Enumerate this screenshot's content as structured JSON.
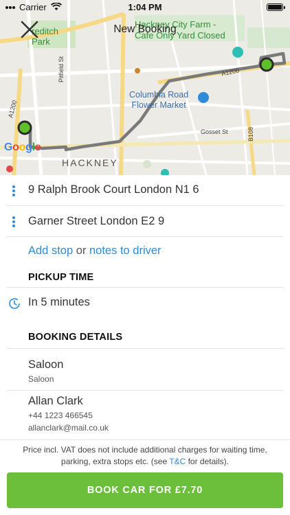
{
  "status_bar": {
    "carrier": "Carrier",
    "time": "1:04 PM"
  },
  "nav": {
    "title": "New Booking",
    "close_icon": "close-icon"
  },
  "map": {
    "labels": {
      "park": "Shoreditch Park",
      "park_line1": "reditch",
      "park_line2": "Park",
      "farm_line1": "Hackney City Farm -",
      "farm_line2": "Cafe Only Yard Closed",
      "columbia_line1": "Columbia Road",
      "columbia_line2": "Flower Market",
      "hackney": "HACKNEY",
      "pitfield": "Pitfield St",
      "a1208": "A1208",
      "a1200": "A1200",
      "gosset": "Gosset St",
      "b108": "B108"
    },
    "logo": "Google",
    "route_color": "#7a7a7a",
    "marker_color": "#5fbf2a"
  },
  "route": {
    "pickup": "9 Ralph Brook Court London N1 6",
    "dropoff": "Garner Street London E2 9",
    "add_stop": "Add stop",
    "or": "or",
    "notes": "notes to driver"
  },
  "pickup_time": {
    "heading": "PICKUP TIME",
    "value": "In 5 minutes"
  },
  "booking_details": {
    "heading": "BOOKING DETAILS",
    "vehicle_title": "Saloon",
    "vehicle_sub": "Saloon",
    "passenger_name": "Allan Clark",
    "passenger_phone": "+44 1223 466545",
    "passenger_email": "allanclark@mail.co.uk"
  },
  "footer": {
    "note_before": "Price incl. VAT does not include additional charges for waiting time, parking, extra stops etc. (see ",
    "tc_link": "T&C",
    "note_after": " for details)."
  },
  "book_button": "BOOK CAR FOR £7.70",
  "colors": {
    "accent": "#2e8bd8",
    "book_button": "#6cbf3a"
  }
}
